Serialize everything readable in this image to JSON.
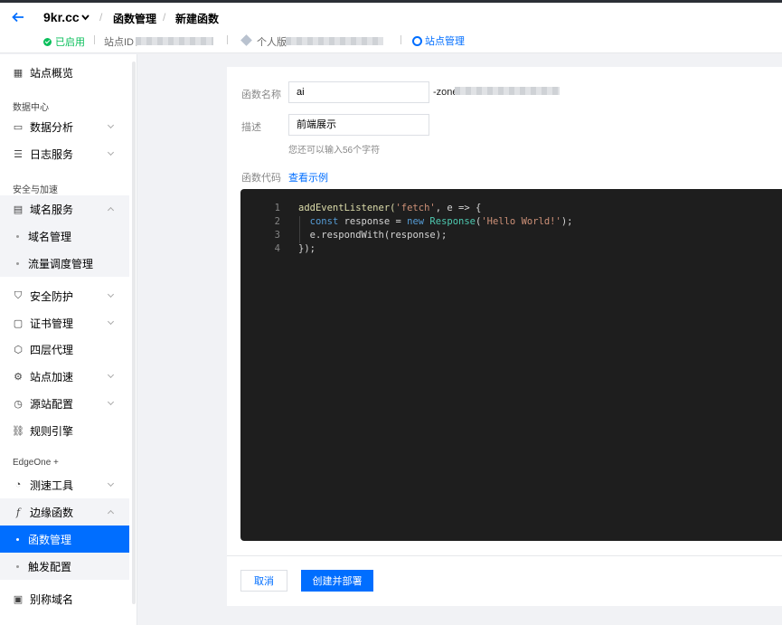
{
  "header": {
    "site_name": "9kr.cc",
    "breadcrumb": [
      "函数管理",
      "新建函数"
    ],
    "status": "已启用",
    "site_id_label": "站点ID：",
    "plan_label": "个人版",
    "manage_link": "站点管理"
  },
  "sidebar": {
    "items": [
      {
        "label": "站点概览",
        "icon": "overview-icon"
      },
      {
        "group": "数据中心"
      },
      {
        "label": "数据分析",
        "icon": "chart-icon",
        "chevron": "down"
      },
      {
        "label": "日志服务",
        "icon": "log-icon",
        "chevron": "down"
      },
      {
        "group": "安全与加速"
      },
      {
        "label": "域名服务",
        "icon": "domain-icon",
        "chevron": "up",
        "expanded": true
      },
      {
        "label": "域名管理",
        "sub": true
      },
      {
        "label": "流量调度管理",
        "sub": true
      },
      {
        "label": "安全防护",
        "icon": "shield-icon",
        "chevron": "down"
      },
      {
        "label": "证书管理",
        "icon": "certificate-icon",
        "chevron": "down"
      },
      {
        "label": "四层代理",
        "icon": "proxy-icon"
      },
      {
        "label": "站点加速",
        "icon": "accelerate-icon",
        "chevron": "down"
      },
      {
        "label": "源站配置",
        "icon": "origin-icon",
        "chevron": "down"
      },
      {
        "label": "规则引擎",
        "icon": "link-icon"
      },
      {
        "group": "EdgeOne +"
      },
      {
        "label": "测速工具",
        "icon": "speed-icon",
        "chevron": "down"
      },
      {
        "label": "边缘函数",
        "icon": "fx-icon",
        "chevron": "up",
        "expanded": true
      },
      {
        "label": "函数管理",
        "sub": true,
        "active": true
      },
      {
        "label": "触发配置",
        "sub": true
      },
      {
        "label": "别称域名",
        "icon": "alias-icon"
      }
    ]
  },
  "form": {
    "name_label": "函数名称",
    "name_value": "ai",
    "name_suffix": "-zone",
    "desc_label": "描述",
    "desc_value": "前端展示",
    "desc_hint": "您还可以输入56个字符",
    "code_label": "函数代码",
    "example_link": "查看示例"
  },
  "code": {
    "line_numbers": [
      "1",
      "2",
      "3",
      "4"
    ],
    "l1_a": "addEventListener(",
    "l1_str": "'fetch'",
    "l1_b": ", e => {",
    "l2_kw": "const",
    "l2_a": " response = ",
    "l2_new": "new",
    "l2_cls": "Response",
    "l2_b": "(",
    "l2_str": "'Hello World!'",
    "l2_c": ");",
    "l3": "e.respondWith(response);",
    "l4": "});"
  },
  "actions": {
    "cancel": "取消",
    "create": "创建并部署"
  },
  "colors": {
    "accent": "#006eff",
    "success": "#0abf5b",
    "editor_bg": "#1e1e1e"
  }
}
